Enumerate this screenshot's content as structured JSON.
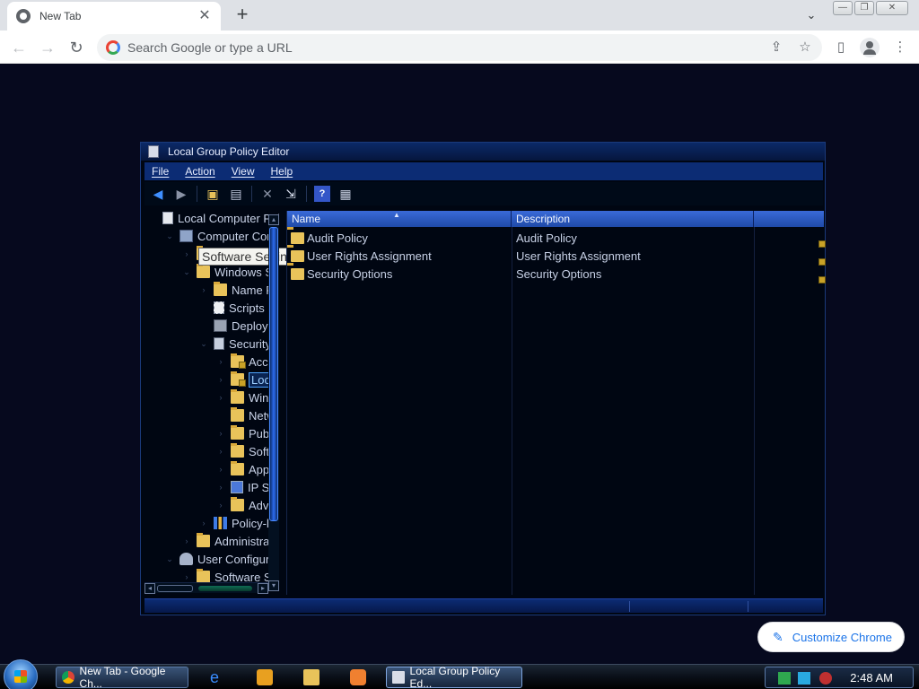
{
  "browser": {
    "tab_title": "New Tab",
    "tab_close": "✕",
    "new_tab": "+",
    "tab_search": "⌄",
    "back": "←",
    "forward": "→",
    "reload": "↻",
    "omnibox_placeholder": "Search Google or type a URL",
    "share": "⇪",
    "bookmark": "☆",
    "sidepanel": "▯",
    "menu": "⋮",
    "min": "—",
    "restore": "❐",
    "close": "✕"
  },
  "gpedit": {
    "title": "Local Group Policy Editor",
    "menus": [
      "File",
      "Action",
      "View",
      "Help"
    ],
    "tree": [
      {
        "label": "Local Computer Pol",
        "icon": "doc",
        "indent": 0,
        "expander": ""
      },
      {
        "label": "Computer Config",
        "icon": "computer",
        "indent": 1,
        "expander": "⌄"
      },
      {
        "label": "Software Set",
        "icon": "folder",
        "indent": 2,
        "expander": "›"
      },
      {
        "label": "Windows Set",
        "icon": "folder",
        "indent": 2,
        "expander": "⌄"
      },
      {
        "label": "Name Res",
        "icon": "folder",
        "indent": 3,
        "expander": "›"
      },
      {
        "label": "Scripts (S",
        "icon": "script",
        "indent": 3,
        "expander": ""
      },
      {
        "label": "Deployed",
        "icon": "printer",
        "indent": 3,
        "expander": ""
      },
      {
        "label": "Security S",
        "icon": "shield",
        "indent": 3,
        "expander": "⌄"
      },
      {
        "label": "Accou",
        "icon": "folder lock",
        "indent": 4,
        "expander": "›"
      },
      {
        "label": "Local I",
        "icon": "folder lock",
        "indent": 4,
        "expander": "›",
        "selected": true
      },
      {
        "label": "Windo",
        "icon": "folder",
        "indent": 4,
        "expander": "›"
      },
      {
        "label": "Netwo",
        "icon": "folder",
        "indent": 4,
        "expander": ""
      },
      {
        "label": "Public",
        "icon": "folder",
        "indent": 4,
        "expander": "›"
      },
      {
        "label": "Softwa",
        "icon": "folder",
        "indent": 4,
        "expander": "›"
      },
      {
        "label": "Applic",
        "icon": "folder",
        "indent": 4,
        "expander": "›"
      },
      {
        "label": "IP Sec",
        "icon": "ipsec",
        "indent": 4,
        "expander": "›"
      },
      {
        "label": "Advan",
        "icon": "folder",
        "indent": 4,
        "expander": "›"
      },
      {
        "label": "Policy-bas",
        "icon": "chart",
        "indent": 3,
        "expander": "›"
      },
      {
        "label": "Administrativ",
        "icon": "folder",
        "indent": 2,
        "expander": "›"
      },
      {
        "label": "User Configurati",
        "icon": "users",
        "indent": 1,
        "expander": "⌄"
      },
      {
        "label": "Software Set",
        "icon": "folder",
        "indent": 2,
        "expander": "›"
      }
    ],
    "tooltip": "Software Settings",
    "columns": {
      "name": "Name",
      "description": "Description"
    },
    "rows": [
      {
        "name": "Audit Policy",
        "description": "Audit Policy"
      },
      {
        "name": "User Rights Assignment",
        "description": "User Rights Assignment"
      },
      {
        "name": "Security Options",
        "description": "Security Options"
      }
    ]
  },
  "customize_chrome": "Customize Chrome",
  "taskbar": {
    "items": [
      "New Tab - Google Ch...",
      "Local Group Policy Ed..."
    ],
    "clock": "2:48 AM"
  }
}
